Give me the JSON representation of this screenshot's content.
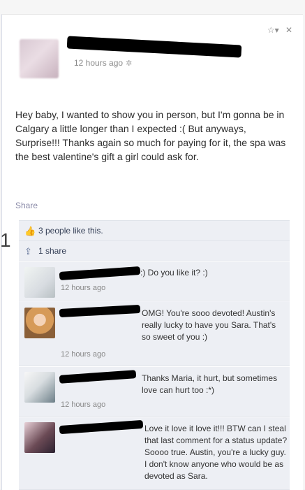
{
  "header": {
    "options": "☆▾",
    "close": "✕",
    "time": "12 hours ago",
    "gear": "✲"
  },
  "post": {
    "text": "Hey baby, I wanted to show you in person, but I'm gonna be in Calgary a little longer than I expected :( But anyways, Surprise!!! Thanks again so much for paying for it, the spa was the best valentine's gift a girl could ask for.",
    "share_label": "Share"
  },
  "side_label": "1",
  "likes": {
    "text": "3 people like this.",
    "icon": "👍"
  },
  "shares": {
    "text": "1 share",
    "icon": "⇪"
  },
  "comments": [
    {
      "text": ":) Do you like it? :)",
      "time": "12 hours ago"
    },
    {
      "text": "OMG! You're sooo devoted! Austin's really lucky to have you Sara. That's so sweet of you :)",
      "time": "12 hours ago"
    },
    {
      "text": "Thanks Maria, it hurt, but sometimes love can hurt too :*)",
      "time": "12 hours ago"
    },
    {
      "text": "Love it love it love it!!! BTW can I steal that last comment for a status update? Soooo true. Austin, you're a lucky guy. I don't know anyone who would be as devoted as Sara.",
      "time": ""
    }
  ]
}
